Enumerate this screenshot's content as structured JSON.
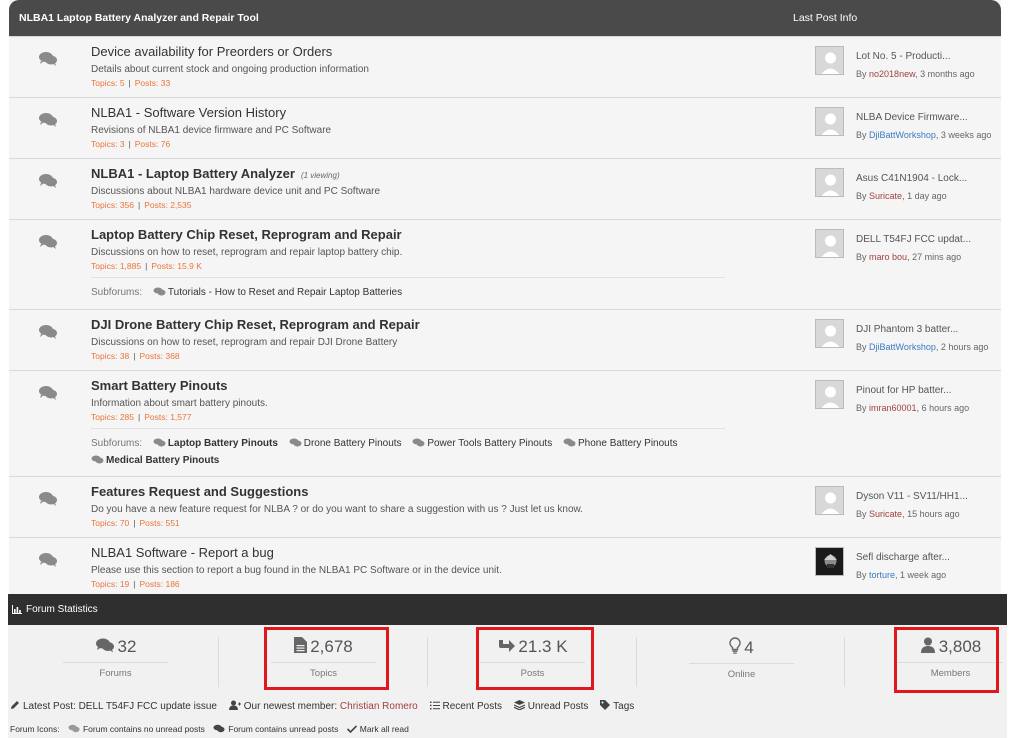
{
  "header": {
    "title": "NLBA1 Laptop Battery Analyzer and Repair Tool",
    "last_post_info": "Last Post Info"
  },
  "forums": [
    {
      "title": "Device availability for Preorders or Orders",
      "description": "Details about current stock and ongoing production information",
      "topics": "Topics: 5",
      "posts": "Posts: 33",
      "last_post": "Lot No. 5 - Producti...",
      "by": "By",
      "user": "no2018new",
      "when": ", 3 months ago"
    },
    {
      "title": "NLBA1 - Software Version History",
      "description": "Revisions of NLBA1 device firmware and PC Software",
      "topics": "Topics: 3",
      "posts": "Posts: 76",
      "last_post": "NLBA Device Firmware...",
      "by": "By",
      "user": "DjiBattWorkshop",
      "when": ", 3 weeks ago"
    },
    {
      "title": "NLBA1 - Laptop Battery Analyzer",
      "viewing": "(1 viewing)",
      "description": "Discussions about NLBA1 hardware device unit and PC Software",
      "topics": "Topics: 356",
      "posts": "Posts: 2,535",
      "last_post": "Asus C41N1904 - Lock...",
      "by": "By",
      "user": "Suricate",
      "when": ", 1 day ago"
    },
    {
      "title": "Laptop Battery Chip Reset, Reprogram and Repair",
      "description": "Discussions on how to reset, reprogram and repair laptop battery chip.",
      "topics": "Topics: 1,885",
      "posts": "Posts: 15.9 K",
      "last_post": "DELL T54FJ FCC updat...",
      "by": "By",
      "user": "maro bou",
      "when": ", 27 mins ago",
      "subforums_label": "Subforums:",
      "subforums": [
        "Tutorials - How to Reset and Repair Laptop Batteries"
      ]
    },
    {
      "title": "DJI Drone Battery Chip Reset, Reprogram and Repair",
      "description": "Discussions on how to reset, reprogram and repair DJI Drone Battery",
      "topics": "Topics: 38",
      "posts": "Posts: 368",
      "last_post": "DJI Phantom 3 batter...",
      "by": "By",
      "user": "DjiBattWorkshop",
      "when": ", 2 hours ago"
    },
    {
      "title": "Smart Battery Pinouts",
      "description": "Information about smart battery pinouts.",
      "topics": "Topics: 285",
      "posts": "Posts: 1,577",
      "last_post": "Pinout for HP batter...",
      "by": "By",
      "user": "imran60001",
      "when": ", 6 hours ago",
      "subforums_label": "Subforums:",
      "subforums": [
        "Laptop Battery Pinouts",
        "Drone Battery Pinouts",
        "Power Tools Battery Pinouts",
        "Phone Battery Pinouts",
        "Medical Battery Pinouts"
      ]
    },
    {
      "title": "Features Request and Suggestions",
      "description": "Do you have a new feature request for NLBA ? or do you want to share a suggestion with us ? Just let us know.",
      "topics": "Topics: 70",
      "posts": "Posts: 551",
      "last_post": "Dyson V11 - SV11/HH1...",
      "by": "By",
      "user": "Suricate",
      "when": ", 15 hours ago"
    },
    {
      "title": "NLBA1 Software - Report a bug",
      "description": "Please use this section to report a bug found in the NLBA1 PC Software or in the device unit.",
      "topics": "Topics: 19",
      "posts": "Posts: 186",
      "last_post": "Sefl discharge after...",
      "by": "By",
      "user": "torture",
      "when": ", 1 week ago"
    }
  ],
  "stats": {
    "title": "Forum Statistics",
    "items": [
      {
        "value": "32",
        "label": "Forums",
        "icon": "comments-icon"
      },
      {
        "value": "2,678",
        "label": "Topics",
        "icon": "file-icon"
      },
      {
        "value": "21.3 K",
        "label": "Posts",
        "icon": "reply-arrow-icon"
      },
      {
        "value": "4",
        "label": "Online",
        "icon": "lightbulb-icon"
      },
      {
        "value": "3,808",
        "label": "Members",
        "icon": "user-icon"
      }
    ]
  },
  "info": {
    "latest_post": "Latest Post: DELL T54FJ FCC update issue",
    "newest_member_label": "Our newest member:",
    "newest_member": "Christian Romero",
    "recent_posts": "Recent Posts",
    "unread_posts": "Unread Posts",
    "tags": "Tags"
  },
  "legend": {
    "label": "Forum Icons:",
    "no_unread": "Forum contains no unread posts",
    "unread": "Forum contains unread posts",
    "mark_all_read": "Mark all read"
  },
  "colors": {
    "header_bg": "#4a4a4a",
    "stats_bar_bg": "#2f2f2f",
    "stat_orange": "#e8753a",
    "user_red": "#a04040",
    "user_blue": "#3c7ac0",
    "highlight_red": "#e0181c"
  }
}
